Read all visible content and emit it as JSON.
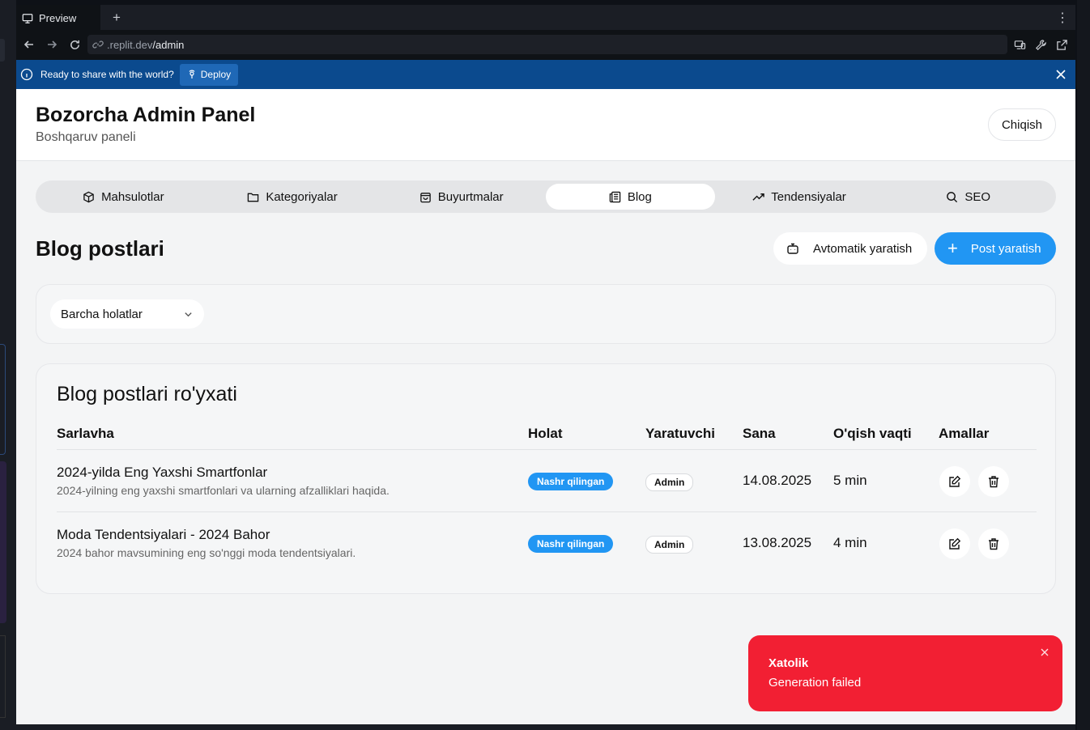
{
  "browser": {
    "tab_label": "Preview",
    "new_tab": "+",
    "more": "⋮",
    "url_host": ".replit.dev",
    "url_path": "/admin"
  },
  "banner": {
    "text": "Ready to share with the world?",
    "deploy_label": "Deploy"
  },
  "header": {
    "title": "Bozorcha Admin Panel",
    "subtitle": "Boshqaruv paneli",
    "logout_label": "Chiqish"
  },
  "tabs": [
    {
      "label": "Mahsulotlar",
      "icon": "box-icon"
    },
    {
      "label": "Kategoriyalar",
      "icon": "folder-icon"
    },
    {
      "label": "Buyurtmalar",
      "icon": "shopping-bag-icon"
    },
    {
      "label": "Blog",
      "icon": "newspaper-icon",
      "active": true
    },
    {
      "label": "Tendensiyalar",
      "icon": "trending-up-icon"
    },
    {
      "label": "SEO",
      "icon": "search-icon"
    }
  ],
  "main": {
    "title": "Blog postlari",
    "auto_label": "Avtomatik yaratish",
    "create_label": "Post yaratish",
    "create_plus": "+"
  },
  "filter": {
    "status_value": "Barcha holatlar"
  },
  "list": {
    "title": "Blog postlari ro'yxati",
    "columns": [
      "Sarlavha",
      "Holat",
      "Yaratuvchi",
      "Sana",
      "O'qish vaqti",
      "Amallar"
    ],
    "rows": [
      {
        "title": "2024-yilda Eng Yaxshi Smartfonlar",
        "description": "2024-yilning eng yaxshi smartfonlari va ularning afzalliklari haqida.",
        "status": "Nashr qilingan",
        "author": "Admin",
        "date": "14.08.2025",
        "read_time": "5 min"
      },
      {
        "title": "Moda Tendentsiyalari - 2024 Bahor",
        "description": "2024 bahor mavsumining eng so'nggi moda tendentsiyalari.",
        "status": "Nashr qilingan",
        "author": "Admin",
        "date": "13.08.2025",
        "read_time": "4 min"
      }
    ]
  },
  "toast": {
    "title": "Xatolik",
    "message": "Generation failed"
  },
  "colors": {
    "accent": "#2196f3",
    "banner": "#0b4a8e",
    "error": "#f21f33"
  }
}
